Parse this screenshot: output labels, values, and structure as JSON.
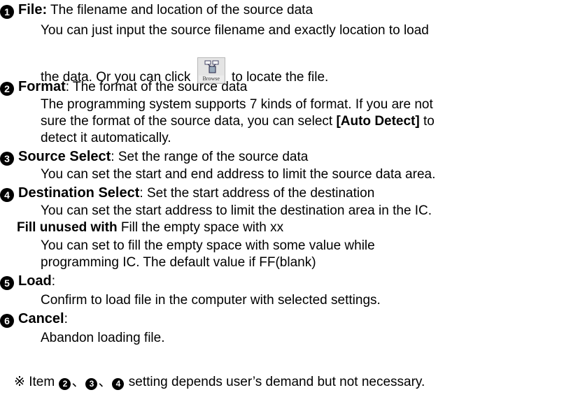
{
  "file": {
    "num": "1",
    "term": "File:",
    "desc": " The filename and location of the source data",
    "line1": "You can just input the source filename and exactly location to load",
    "line2a": "the data. Or you can click",
    "line2b": "to locate the file.",
    "browse_label": "Browse"
  },
  "format": {
    "num": "2",
    "term": "Format",
    "desc": ": The format of the source data",
    "line1": "The programming system supports 7 kinds of format. If you are not",
    "line2a": "sure the format of the source data, you can select ",
    "line2b": "[Auto Detect]",
    "line2c": " to",
    "line3": "detect it automatically."
  },
  "source": {
    "num": "3",
    "term": "Source Select",
    "desc": ": Set the range of the source data",
    "line1": "You can set the start and end address to limit the source data area."
  },
  "destination": {
    "num": "4",
    "term": "Destination Select",
    "desc": ": Set the start address of the destination",
    "line1": "You can set the start address to limit the destination area in the IC."
  },
  "fill": {
    "term": "Fill unused with",
    "desc": " Fill the empty space with xx",
    "line1": "You can set to fill the empty space with some value while",
    "line2": "programming IC. The default value if FF(blank)"
  },
  "load": {
    "num": "5",
    "term": "Load",
    "desc": ":",
    "line1": "Confirm to load file in the computer with selected settings."
  },
  "cancel": {
    "num": "6",
    "term": "Cancel",
    "desc": ":",
    "line1": "Abandon loading file."
  },
  "note": {
    "mark": "※ Item ",
    "n2": "2",
    "sep1": "、",
    "n3": "3",
    "sep2": "、",
    "n4": "4",
    "rest": " setting depends user’s demand but not necessary."
  }
}
